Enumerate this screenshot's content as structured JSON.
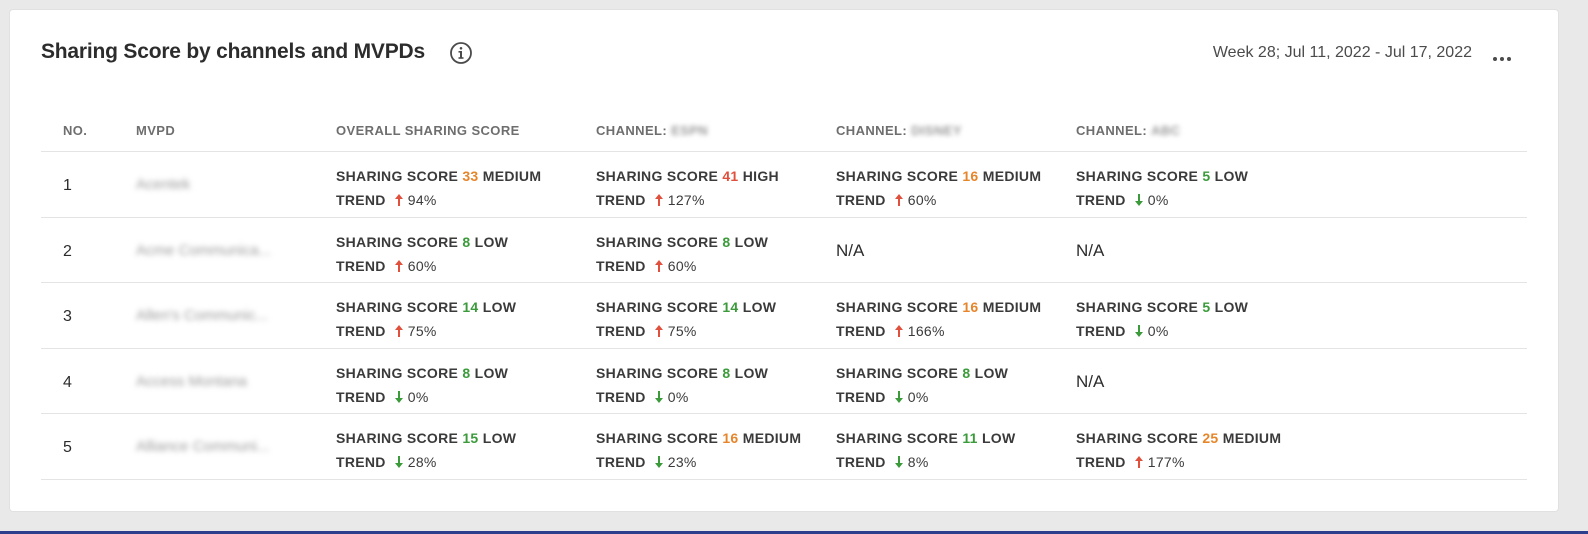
{
  "header": {
    "title": "Sharing Score by channels and MVPDs",
    "date_range": "Week 28; Jul 11, 2022 - Jul 17, 2022"
  },
  "columns": {
    "no": "NO.",
    "mvpd": "MVPD",
    "overall": "OVERALL SHARING SCORE",
    "channel_prefix": "CHANNEL:",
    "channel1": "ESPN",
    "channel2": "DISNEY",
    "channel3": "ABC"
  },
  "labels": {
    "score": "SHARING SCORE",
    "trend": "TREND"
  },
  "colors": {
    "high": "#e0503c",
    "medium": "#e6852a",
    "low": "#3b9b3b",
    "arrow_up": "#e0503c",
    "arrow_down": "#3b9b3b"
  },
  "rows": [
    {
      "no": "1",
      "mvpd": "Acentek",
      "cells": [
        {
          "score": "33",
          "level": "MEDIUM",
          "trend": "up",
          "pct": "94%"
        },
        {
          "score": "41",
          "level": "HIGH",
          "trend": "up",
          "pct": "127%"
        },
        {
          "score": "16",
          "level": "MEDIUM",
          "trend": "up",
          "pct": "60%"
        },
        {
          "score": "5",
          "level": "LOW",
          "trend": "down",
          "pct": "0%"
        }
      ]
    },
    {
      "no": "2",
      "mvpd": "Acme Communica...",
      "cells": [
        {
          "score": "8",
          "level": "LOW",
          "trend": "up",
          "pct": "60%"
        },
        {
          "score": "8",
          "level": "LOW",
          "trend": "up",
          "pct": "60%"
        },
        {
          "na": "N/A"
        },
        {
          "na": "N/A"
        }
      ]
    },
    {
      "no": "3",
      "mvpd": "Allen's Communic...",
      "cells": [
        {
          "score": "14",
          "level": "LOW",
          "trend": "up",
          "pct": "75%"
        },
        {
          "score": "14",
          "level": "LOW",
          "trend": "up",
          "pct": "75%"
        },
        {
          "score": "16",
          "level": "MEDIUM",
          "trend": "up",
          "pct": "166%"
        },
        {
          "score": "5",
          "level": "LOW",
          "trend": "down",
          "pct": "0%"
        }
      ]
    },
    {
      "no": "4",
      "mvpd": "Access Montana",
      "cells": [
        {
          "score": "8",
          "level": "LOW",
          "trend": "down",
          "pct": "0%"
        },
        {
          "score": "8",
          "level": "LOW",
          "trend": "down",
          "pct": "0%"
        },
        {
          "score": "8",
          "level": "LOW",
          "trend": "down",
          "pct": "0%"
        },
        {
          "na": "N/A"
        }
      ]
    },
    {
      "no": "5",
      "mvpd": "Alliance Communi...",
      "cells": [
        {
          "score": "15",
          "level": "LOW",
          "trend": "down",
          "pct": "28%"
        },
        {
          "score": "16",
          "level": "MEDIUM",
          "trend": "down",
          "pct": "23%"
        },
        {
          "score": "11",
          "level": "LOW",
          "trend": "down",
          "pct": "8%"
        },
        {
          "score": "25",
          "level": "MEDIUM",
          "trend": "up",
          "pct": "177%"
        }
      ]
    }
  ]
}
